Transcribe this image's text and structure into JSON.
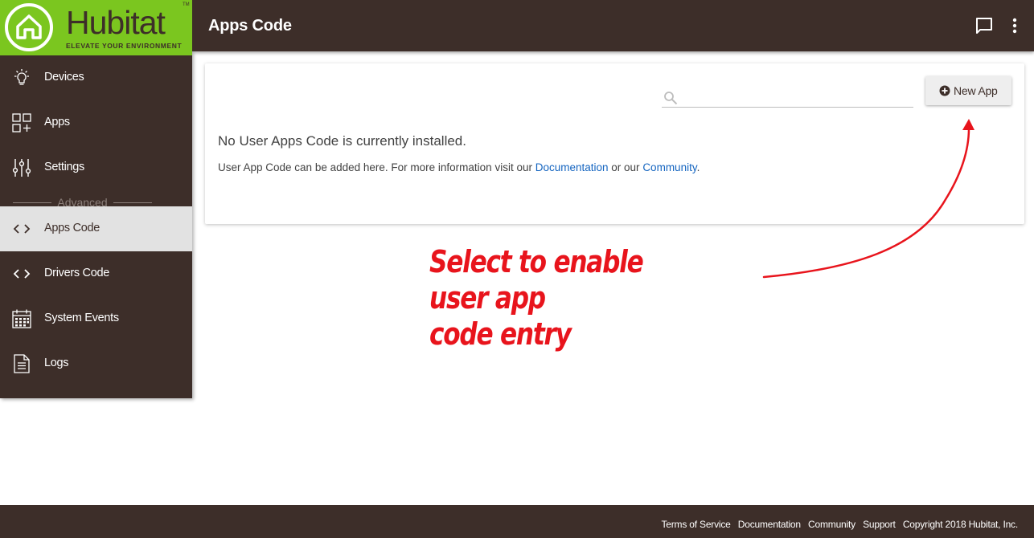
{
  "header": {
    "logo_word": "Hubitat",
    "logo_tm": "TM",
    "logo_tagline": "ELEVATE YOUR ENVIRONMENT",
    "title": "Apps Code",
    "icons": [
      "chat-icon",
      "more-vert-icon"
    ]
  },
  "sidebar": {
    "items": [
      {
        "label": "Devices",
        "icon": "lightbulb-icon"
      },
      {
        "label": "Apps",
        "icon": "apps-grid-icon"
      },
      {
        "label": "Settings",
        "icon": "sliders-icon"
      },
      {
        "label": "Apps Code",
        "icon": "code-icon",
        "active": true
      },
      {
        "label": "Drivers Code",
        "icon": "code-icon"
      },
      {
        "label": "System Events",
        "icon": "calendar-icon"
      },
      {
        "label": "Logs",
        "icon": "document-icon"
      }
    ],
    "divider_label": "Advanced"
  },
  "main": {
    "search": {
      "placeholder": "",
      "value": ""
    },
    "new_app_label": "New App",
    "empty_message": "No User Apps Code is currently installed.",
    "info": {
      "prefix": "User App Code can be added here. For more information visit our ",
      "link1": "Documentation",
      "middle": " or our ",
      "link2": "Community",
      "suffix": "."
    }
  },
  "annotation": {
    "line1": "Select to enable user app",
    "line2": "code entry",
    "color": "#e8141c"
  },
  "footer": {
    "terms": "Terms of Service",
    "documentation": "Documentation",
    "community": "Community",
    "support": "Support",
    "copyright": "Copyright 2018 Hubitat, Inc."
  },
  "colors": {
    "brand_green": "#7bc61f",
    "brand_brown": "#3d2e29",
    "link_blue": "#1565c0"
  }
}
